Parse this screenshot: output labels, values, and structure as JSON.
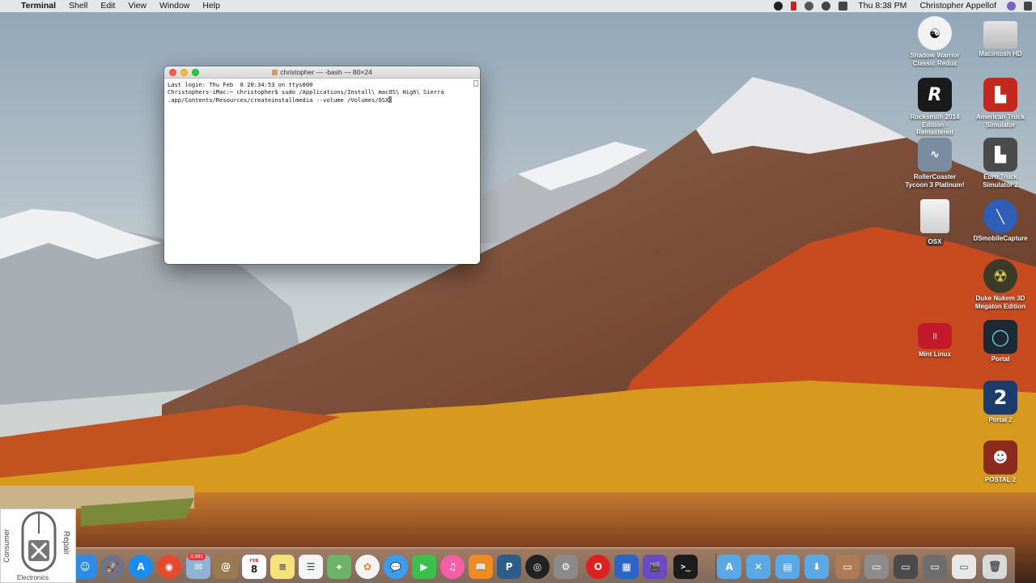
{
  "menubar": {
    "apple_symbol": "",
    "app_name": "Terminal",
    "menus": [
      "Shell",
      "Edit",
      "View",
      "Window",
      "Help"
    ],
    "clock": "Thu 8:38 PM",
    "user": "Christopher Appellof"
  },
  "terminal": {
    "title": "christopher — -bash — 80×24",
    "lines": [
      "Last login: Thu Feb  8 20:34:53 on ttys000",
      "Christophers-iMac:~ christopher$ sudo /Applications/Install\\ macOS\\ High\\ Sierra",
      ".app/Contents/Resources/createinstallmedia --volume /Volumes/OSX"
    ]
  },
  "desktop_icons": [
    {
      "label": "Shadow Warrior Classic Redux",
      "icon": "yin-yang-icon",
      "color": "#f2f2f2"
    },
    {
      "label": "Macintosh HD",
      "icon": "hard-drive-icon",
      "color": "#d7d7d7"
    },
    {
      "label": "Rocksmith 2014 Edition - Remastered",
      "icon": "rocksmith-icon",
      "color": "#1a1a1a"
    },
    {
      "label": "American Truck Simulator",
      "icon": "truck-icon",
      "color": "#c3281f"
    },
    {
      "label": "RollerCoaster Tycoon 3 Platinum!",
      "icon": "rollercoaster-icon",
      "color": "#7c8ca0"
    },
    {
      "label": "Euro Truck Simulator 2",
      "icon": "truck-icon",
      "color": "#4a4a4a"
    },
    {
      "label": "OSX",
      "icon": "external-drive-icon",
      "color": "#e8e8e8"
    },
    {
      "label": "DSmobileCapture",
      "icon": "capture-icon",
      "color": "#2f5fb8"
    },
    {
      "label": "Duke Nukem 3D Megaton Edition",
      "icon": "radiation-icon",
      "color": "#3b3b2a"
    },
    {
      "label": "Mint Linux",
      "icon": "parallels-vm-icon",
      "color": "#c21a2b"
    },
    {
      "label": "Portal",
      "icon": "portal-icon",
      "color": "#1e2a33"
    },
    {
      "label": "Portal 2",
      "icon": "portal2-icon",
      "color": "#1d3c6e"
    },
    {
      "label": "POSTAL 2",
      "icon": "postal-icon",
      "color": "#8a2b1e"
    }
  ],
  "dock": {
    "mail_badge": "3,691",
    "calendar_month": "FEB",
    "calendar_day": "8",
    "items": [
      {
        "name": "finder-icon",
        "glyph": "☺",
        "color": "#2f8be6"
      },
      {
        "name": "launchpad-icon",
        "glyph": "🚀",
        "color": "#6d7486"
      },
      {
        "name": "app-store-icon",
        "glyph": "A",
        "color": "#1a8df0"
      },
      {
        "name": "chrome-icon",
        "glyph": "◉",
        "color": "#e6492d"
      },
      {
        "name": "mail-icon",
        "glyph": "✉",
        "color": "#8fb2d6"
      },
      {
        "name": "contacts-icon",
        "glyph": "@",
        "color": "#9b7a4f"
      },
      {
        "name": "calendar-icon",
        "glyph": "8",
        "color": "#ffffff"
      },
      {
        "name": "notes-icon",
        "glyph": "≡",
        "color": "#f5e27a"
      },
      {
        "name": "reminders-icon",
        "glyph": "☰",
        "color": "#f4f4f4"
      },
      {
        "name": "maps-icon",
        "glyph": "⌖",
        "color": "#6db36a"
      },
      {
        "name": "photos-icon",
        "glyph": "✿",
        "color": "#f3f3f3"
      },
      {
        "name": "messages-icon",
        "glyph": "💬",
        "color": "#3a9ef0"
      },
      {
        "name": "facetime-icon",
        "glyph": "▶",
        "color": "#3cbf4d"
      },
      {
        "name": "itunes-icon",
        "glyph": "♫",
        "color": "#f35ea6"
      },
      {
        "name": "ibooks-icon",
        "glyph": "📖",
        "color": "#f08b22"
      },
      {
        "name": "pandora-icon",
        "glyph": "P",
        "color": "#2e5d8a"
      },
      {
        "name": "obs-icon",
        "glyph": "◎",
        "color": "#222222"
      },
      {
        "name": "system-preferences-icon",
        "glyph": "⚙",
        "color": "#8a8a8a"
      },
      {
        "name": "opera-icon",
        "glyph": "O",
        "color": "#e0201e"
      },
      {
        "name": "parallels-icon",
        "glyph": "▦",
        "color": "#2c64c7"
      },
      {
        "name": "final-cut-icon",
        "glyph": "🎬",
        "color": "#6a4bc2"
      },
      {
        "name": "terminal-icon",
        "glyph": ">_",
        "color": "#1c1c1c"
      },
      {
        "name": "applications-folder-icon",
        "glyph": "A",
        "color": "#5aa9e6"
      },
      {
        "name": "utilities-folder-icon",
        "glyph": "✕",
        "color": "#5aa9e6"
      },
      {
        "name": "documents-folder-icon",
        "glyph": "▤",
        "color": "#5aa9e6"
      },
      {
        "name": "downloads-folder-icon",
        "glyph": "⬇",
        "color": "#5aa9e6"
      },
      {
        "name": "stack-icon-1",
        "glyph": "▭",
        "color": "#b07a55"
      },
      {
        "name": "stack-icon-2",
        "glyph": "▭",
        "color": "#8c8c8c"
      },
      {
        "name": "stack-icon-3",
        "glyph": "▭",
        "color": "#4a4a4a"
      },
      {
        "name": "stack-icon-4",
        "glyph": "▭",
        "color": "#6e6e6e"
      },
      {
        "name": "stack-icon-5",
        "glyph": "▭",
        "color": "#e8e8e8"
      },
      {
        "name": "trash-icon",
        "glyph": "🗑",
        "color": "#d9d9d9"
      }
    ]
  },
  "watermark": {
    "left": "Consumer",
    "right": "Repair",
    "bottom": "Electronics"
  }
}
